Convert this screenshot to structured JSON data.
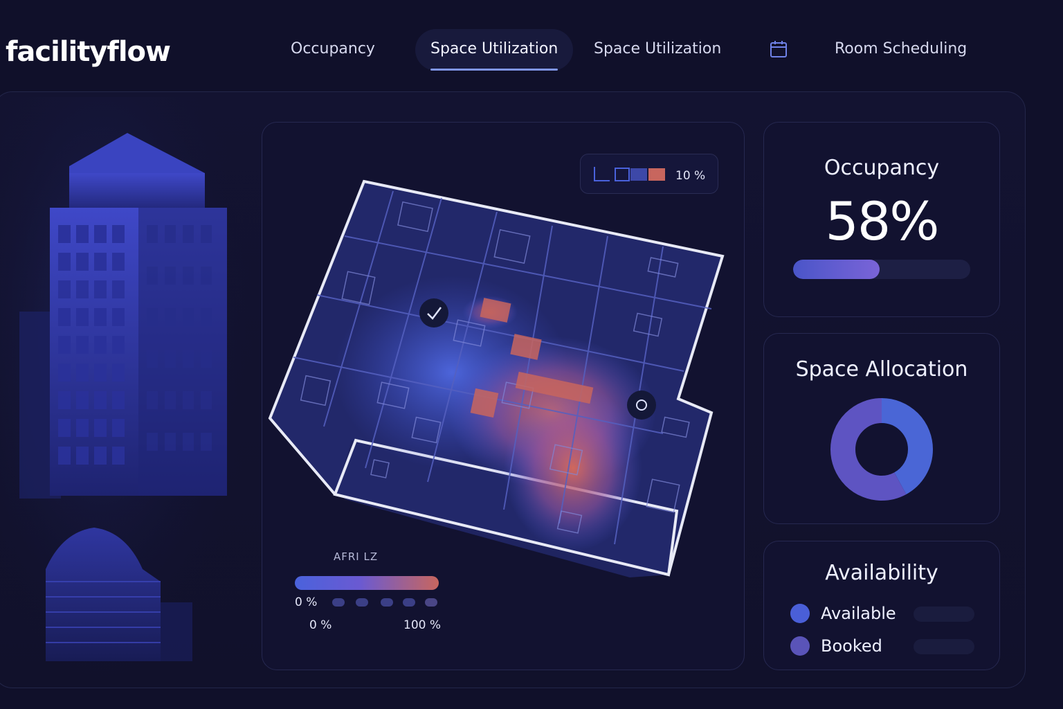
{
  "app": {
    "logo": "facilityflow"
  },
  "nav": {
    "items": [
      {
        "label": "Occupancy"
      },
      {
        "label": "Space Utilization"
      },
      {
        "label": "Space Utilization"
      },
      {
        "label": "Room Scheduling"
      }
    ],
    "active_index": 1,
    "calendar_icon": "calendar-icon"
  },
  "map": {
    "legend_value": "10 %",
    "gradient_title": "AFRI LZ",
    "gradient_min": "0 %",
    "axis_min": "0 %",
    "axis_max": "100 %",
    "markers": [
      "check-icon",
      "circle-marker-icon"
    ]
  },
  "occupancy": {
    "title": "Occupancy",
    "value": "58%",
    "fraction": 0.49
  },
  "allocation": {
    "title": "Space Allocation",
    "slices": [
      {
        "color": "#4a66d6",
        "fraction": 0.42
      },
      {
        "color": "#5e54c2",
        "fraction": 0.58
      }
    ]
  },
  "availability": {
    "title": "Availability",
    "items": [
      {
        "label": "Available",
        "color": "#4a5fd8"
      },
      {
        "label": "Booked",
        "color": "#5a54b8"
      }
    ]
  },
  "colors": {
    "accent": "#7f95e8",
    "background": "#10102a",
    "heat_low": "#4a62dc",
    "heat_high": "#c8665e"
  }
}
